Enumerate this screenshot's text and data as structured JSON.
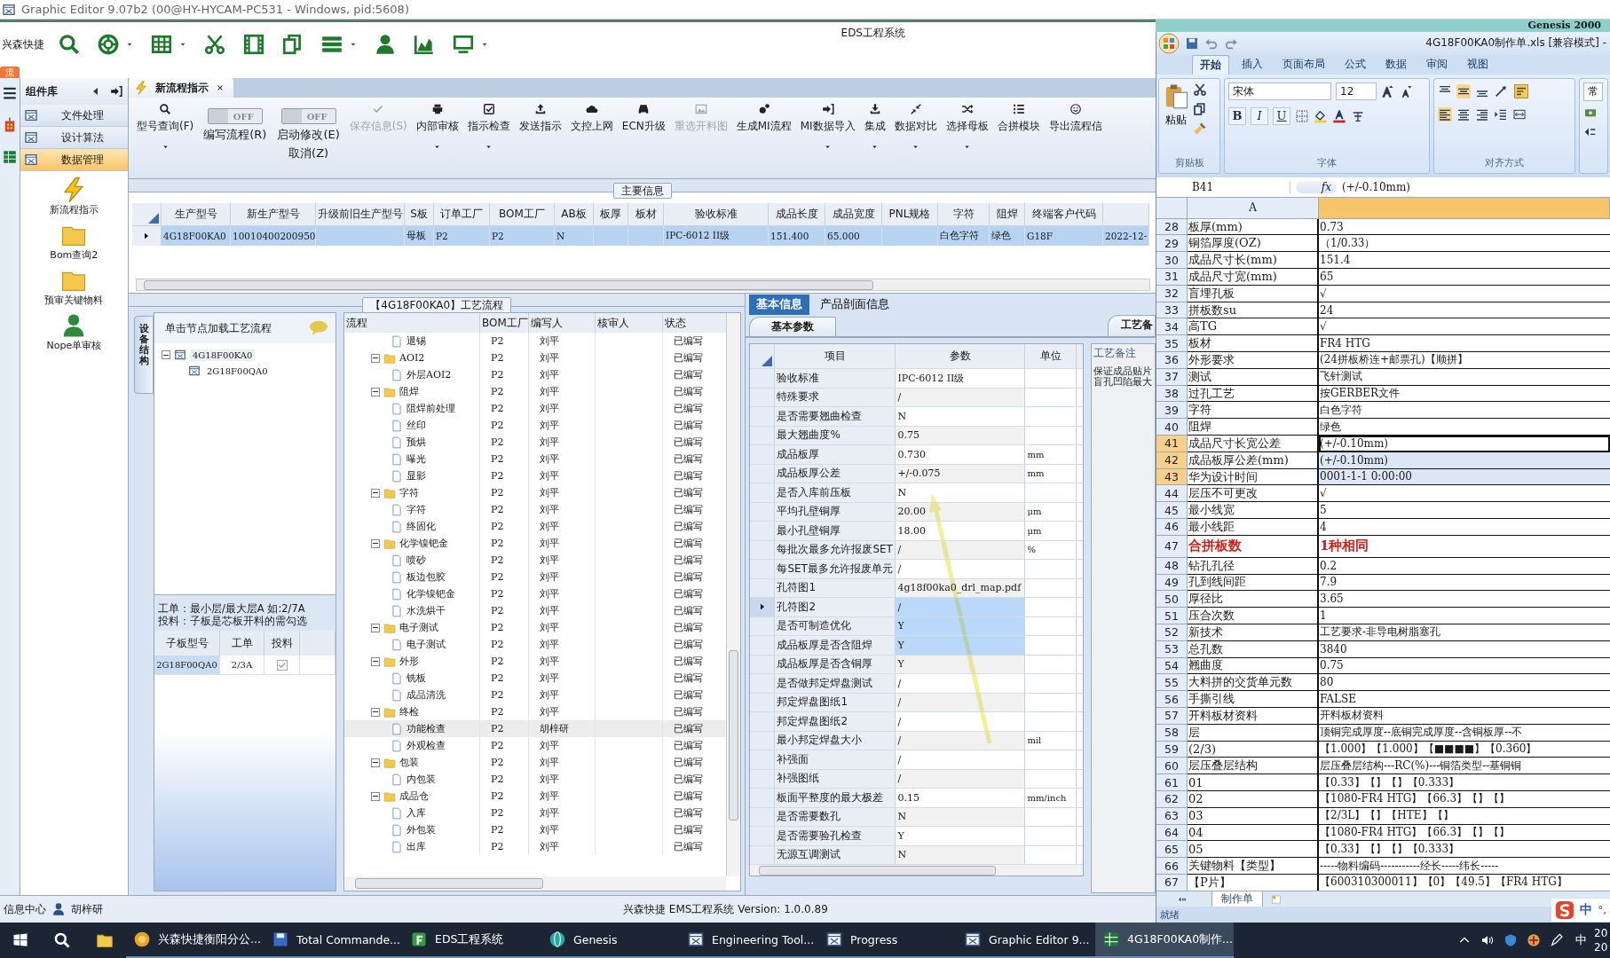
{
  "title_bar": {
    "title": "Graphic Editor 9.07b2 (00@HY-HYCAM-PC531 - Windows, pid:5608)"
  },
  "eds": {
    "quick_bar": {
      "label": "兴森快捷",
      "app_title": "EDS工程系统",
      "icons": [
        {
          "kind": "search",
          "dropdown": false
        },
        {
          "kind": "lifebuoy",
          "dropdown": true
        },
        {
          "kind": "grid",
          "dropdown": true
        },
        {
          "kind": "scissors",
          "dropdown": false
        },
        {
          "kind": "film",
          "dropdown": false
        },
        {
          "kind": "copy",
          "dropdown": false
        },
        {
          "kind": "list",
          "dropdown": true
        },
        {
          "kind": "person",
          "dropdown": false
        },
        {
          "kind": "chart",
          "dropdown": false
        },
        {
          "kind": "monitor",
          "dropdown": true
        }
      ]
    },
    "side_tab": "流",
    "component_library": {
      "title": "组件库",
      "groups": [
        {
          "label": "文件处理",
          "selected": false
        },
        {
          "label": "设计算法",
          "selected": false
        },
        {
          "label": "数据管理",
          "selected": true
        }
      ],
      "tools": [
        {
          "label": "新流程指示",
          "kind": "lightning"
        },
        {
          "label": "Bom查询2",
          "kind": "folder"
        },
        {
          "label": "预审关键物料",
          "kind": "folder"
        },
        {
          "label": "Nope单审核",
          "kind": "person"
        }
      ]
    },
    "doc_tab": {
      "label": "新流程指示"
    },
    "ribbon": [
      {
        "kind": "button",
        "label": "型号查询(F)",
        "dropdown": true,
        "disabled": false
      },
      {
        "kind": "toggle",
        "label": "编写流程(R)",
        "state_text": "OFF",
        "on": false
      },
      {
        "kind": "toggle",
        "label": "启动修改(E)",
        "label2": "取消(Z)",
        "state_text": "OFF",
        "on": false
      },
      {
        "kind": "button",
        "label": "保存信息(S)",
        "dropdown": false,
        "disabled": true
      },
      {
        "kind": "button",
        "label": "内部审核",
        "dropdown": true,
        "disabled": false
      },
      {
        "kind": "button",
        "label": "指示检查",
        "dropdown": true,
        "disabled": false
      },
      {
        "kind": "button",
        "label": "发送指示",
        "dropdown": false,
        "disabled": false
      },
      {
        "kind": "button",
        "label": "文控上网",
        "dropdown": false,
        "disabled": false
      },
      {
        "kind": "button",
        "label": "ECN升级",
        "dropdown": false,
        "disabled": false
      },
      {
        "kind": "button",
        "label": "重选开料图",
        "dropdown": false,
        "disabled": true
      },
      {
        "kind": "button",
        "label": "生成MI流程",
        "dropdown": false,
        "disabled": false
      },
      {
        "kind": "button",
        "label": "MI数据导入",
        "dropdown": true,
        "disabled": false
      },
      {
        "kind": "button",
        "label": "集成",
        "dropdown": true,
        "disabled": false
      },
      {
        "kind": "button",
        "label": "数据对比",
        "dropdown": true,
        "disabled": false
      },
      {
        "kind": "button",
        "label": "选择母板",
        "dropdown": true,
        "disabled": false
      },
      {
        "kind": "button",
        "label": "合拼模块",
        "dropdown": false,
        "disabled": false
      },
      {
        "kind": "button",
        "label": "导出流程信",
        "dropdown": false,
        "disabled": false
      }
    ],
    "main_info": {
      "caption": "主要信息",
      "columns": [
        {
          "label": "生产型号"
        },
        {
          "label": "新生产型号"
        },
        {
          "label": "升级前旧生产型号"
        },
        {
          "label": "S板"
        },
        {
          "label": "订单工厂"
        },
        {
          "label": "BOM工厂"
        },
        {
          "label": "AB板"
        },
        {
          "label": "板厚"
        },
        {
          "label": "板材"
        },
        {
          "label": "验收标准"
        },
        {
          "label": "成品长度"
        },
        {
          "label": "成品宽度"
        },
        {
          "label": "PNL规格"
        },
        {
          "label": "字符"
        },
        {
          "label": "阻焊"
        },
        {
          "label": "终端客户代码"
        },
        {}
      ],
      "rows": [
        {
          "selected": true,
          "cells": [
            "4G18F00KA0",
            "10010400200950",
            null,
            "母板",
            "P2",
            "P2",
            "N",
            null,
            null,
            "IPC-6012 II级",
            "151.400",
            "65.000",
            null,
            "白色字符",
            "绿色",
            "G18F",
            "2022-12-"
          ]
        }
      ]
    },
    "process": {
      "caption": "【4G18F00KA0】工艺流程",
      "side_tab": "设备结构",
      "hint": "单击节点加载工艺流程",
      "tree": [
        {
          "label": "4G18F00KA0",
          "selected": true,
          "expanded": true,
          "children": [
            {
              "label": "2G18F00QA0",
              "selected": false
            }
          ]
        }
      ],
      "notes": [
        "工单：最小层/最大层A 如:2/7A",
        "投料：子板是芯板开料的需勾选"
      ],
      "sub_table": {
        "columns": [
          "子板型号",
          "工单",
          "投料"
        ],
        "rows": [
          {
            "model": "2G18F00QA0",
            "order": "2/3A",
            "checked": true
          }
        ]
      },
      "grid": {
        "columns": [
          "流程",
          "BOM工厂",
          "编写人",
          "核审人",
          "状态"
        ],
        "items": [
          {
            "children": [
              {
                "label": "退锡",
                "bom": "P2",
                "writer": "刘平",
                "status": "已编写",
                "selected": false
              }
            ]
          },
          {
            "label": "AOI2",
            "bom": "P2",
            "writer": "刘平",
            "status": "已编写",
            "selected": false,
            "expanded": true,
            "children": [
              {
                "label": "外层AOI2",
                "bom": "P2",
                "writer": "刘平",
                "status": "已编写",
                "selected": false
              }
            ]
          },
          {
            "label": "阻焊",
            "bom": "P2",
            "writer": "刘平",
            "status": "已编写",
            "selected": false,
            "expanded": true,
            "children": [
              {
                "label": "阻焊前处理",
                "bom": "P2",
                "writer": "刘平",
                "status": "已编写",
                "selected": false
              },
              {
                "label": "丝印",
                "bom": "P2",
                "writer": "刘平",
                "status": "已编写",
                "selected": false
              },
              {
                "label": "预烘",
                "bom": "P2",
                "writer": "刘平",
                "status": "已编写",
                "selected": false
              },
              {
                "label": "曝光",
                "bom": "P2",
                "writer": "刘平",
                "status": "已编写",
                "selected": false
              },
              {
                "label": "显影",
                "bom": "P2",
                "writer": "刘平",
                "status": "已编写",
                "selected": false
              }
            ]
          },
          {
            "label": "字符",
            "bom": "P2",
            "writer": "刘平",
            "status": "已编写",
            "selected": false,
            "expanded": true,
            "children": [
              {
                "label": "字符",
                "bom": "P2",
                "writer": "刘平",
                "status": "已编写",
                "selected": false
              },
              {
                "label": "终固化",
                "bom": "P2",
                "writer": "刘平",
                "status": "已编写",
                "selected": false
              }
            ]
          },
          {
            "label": "化学镍钯金",
            "bom": "P2",
            "writer": "刘平",
            "status": "已编写",
            "selected": false,
            "expanded": true,
            "children": [
              {
                "label": "喷砂",
                "bom": "P2",
                "writer": "刘平",
                "status": "已编写",
                "selected": false
              },
              {
                "label": "板边包胶",
                "bom": "P2",
                "writer": "刘平",
                "status": "已编写",
                "selected": false
              },
              {
                "label": "化学镍钯金",
                "bom": "P2",
                "writer": "刘平",
                "status": "已编写",
                "selected": false
              },
              {
                "label": "水洗烘干",
                "bom": "P2",
                "writer": "刘平",
                "status": "已编写",
                "selected": false
              }
            ]
          },
          {
            "label": "电子测试",
            "bom": "P2",
            "writer": "刘平",
            "status": "已编写",
            "selected": false,
            "expanded": true,
            "children": [
              {
                "label": "电子测试",
                "bom": "P2",
                "writer": "刘平",
                "status": "已编写",
                "selected": false
              }
            ]
          },
          {
            "label": "外形",
            "bom": "P2",
            "writer": "刘平",
            "status": "已编写",
            "selected": false,
            "expanded": true,
            "children": [
              {
                "label": "铣板",
                "bom": "P2",
                "writer": "刘平",
                "status": "已编写",
                "selected": false
              },
              {
                "label": "成品清洗",
                "bom": "P2",
                "writer": "刘平",
                "status": "已编写",
                "selected": false
              }
            ]
          },
          {
            "label": "终检",
            "bom": "P2",
            "writer": "刘平",
            "status": "已编写",
            "selected": false,
            "expanded": true,
            "children": [
              {
                "label": "功能检查",
                "bom": "P2",
                "writer": "胡梓研",
                "status": "已编写",
                "selected": true
              },
              {
                "label": "外观检查",
                "bom": "P2",
                "writer": "刘平",
                "status": "已编写",
                "selected": false
              }
            ]
          },
          {
            "label": "包装",
            "bom": "P2",
            "writer": "刘平",
            "status": "已编写",
            "selected": false,
            "expanded": true,
            "children": [
              {
                "label": "内包装",
                "bom": "P2",
                "writer": "刘平",
                "status": "已编写",
                "selected": false
              }
            ]
          },
          {
            "label": "成品仓",
            "bom": "P2",
            "writer": "刘平",
            "status": "已编写",
            "selected": false,
            "expanded": true,
            "children": [
              {
                "label": "入库",
                "bom": "P2",
                "writer": "刘平",
                "status": "已编写",
                "selected": false
              },
              {
                "label": "外包装",
                "bom": "P2",
                "writer": "刘平",
                "status": "已编写",
                "selected": false
              },
              {
                "label": "出库",
                "bom": "P2",
                "writer": "刘平",
                "status": "已编写",
                "selected": false
              }
            ]
          }
        ]
      }
    },
    "params": {
      "tabs": [
        {
          "label": "基本信息",
          "selected": true
        },
        {
          "label": "产品剖面信息",
          "selected": false
        }
      ],
      "sub_tab": "基本参数",
      "columns": [
        "项目",
        "参数",
        "单位"
      ],
      "rows": [
        {
          "item": "验收标准",
          "value": "IPC-6012 II级",
          "selected": false,
          "current": false
        },
        {
          "item": "特殊要求",
          "value": "/",
          "selected": false,
          "current": false
        },
        {
          "item": "是否需要翘曲检查",
          "value": "N",
          "selected": false,
          "current": false
        },
        {
          "item": "最大翘曲度%",
          "value": "0.75",
          "selected": false,
          "current": false
        },
        {
          "item": "成品板厚",
          "value": "0.730",
          "unit": "mm",
          "selected": false,
          "current": false
        },
        {
          "item": "成品板厚公差",
          "value": "+/-0.075",
          "unit": "mm",
          "selected": false,
          "current": false
        },
        {
          "item": "是否入库前压板",
          "value": "N",
          "selected": false,
          "current": false
        },
        {
          "item": "平均孔壁铜厚",
          "value": "20.00",
          "unit": "μm",
          "selected": false,
          "current": false
        },
        {
          "item": "最小孔壁铜厚",
          "value": "18.00",
          "unit": "μm",
          "selected": false,
          "current": false
        },
        {
          "item": "每批次最多允许报废SET",
          "value": "/",
          "unit": "%",
          "selected": false,
          "current": false
        },
        {
          "item": "每SET最多允许报废单元",
          "value": "/",
          "selected": false,
          "current": false
        },
        {
          "item": "孔符图1",
          "value": "4g18f00ka0_drl_map.pdf",
          "selected": false,
          "current": false
        },
        {
          "item": "孔符图2",
          "value": "/",
          "selected": true,
          "current": true
        },
        {
          "item": "是否可制造优化",
          "value": "Y",
          "selected": true,
          "current": false
        },
        {
          "item": "成品板厚是否含阻焊",
          "value": "Y",
          "selected": true,
          "current": false
        },
        {
          "item": "成品板厚是否含铜厚",
          "value": "Y",
          "selected": false,
          "current": false
        },
        {
          "item": "是否做邦定焊盘测试",
          "value": "/",
          "selected": false,
          "current": false
        },
        {
          "item": "邦定焊盘图纸1",
          "value": "/",
          "selected": false,
          "current": false
        },
        {
          "item": "邦定焊盘图纸2",
          "value": "/",
          "selected": false,
          "current": false
        },
        {
          "item": "最小邦定焊盘大小",
          "value": "/",
          "unit": "mil",
          "selected": false,
          "current": false
        },
        {
          "item": "补强面",
          "value": "/",
          "selected": false,
          "current": false
        },
        {
          "item": "补强图纸",
          "value": "/",
          "selected": false,
          "current": false
        },
        {
          "item": "板面平整度的最大极差",
          "value": "0.15",
          "unit": "mm/inch",
          "selected": false,
          "current": false
        },
        {
          "item": "是否需要数孔",
          "value": "N",
          "selected": false,
          "current": false
        },
        {
          "item": "是否需要验孔检查",
          "value": "Y",
          "selected": false,
          "current": false
        },
        {
          "item": "无源互调测试",
          "value": "N",
          "selected": false,
          "current": false
        }
      ]
    },
    "remarks": {
      "tab": "工艺备",
      "label": "工艺备注",
      "lines": [
        "保证成品贴片",
        "盲孔凹陷最大"
      ]
    },
    "status_bar": {
      "info": "信息中心",
      "user": "胡梓研",
      "version": "兴森快捷 EMS工程系统 Version: 1.0.0.89"
    }
  },
  "genesis": {
    "title": "Genesis 2000"
  },
  "excel": {
    "title": "4G18F00KA0制作单.xls  [兼容模式] -",
    "tabs": [
      {
        "label": "开始",
        "selected": true
      },
      {
        "label": "插入",
        "selected": false
      },
      {
        "label": "页面布局",
        "selected": false
      },
      {
        "label": "公式",
        "selected": false
      },
      {
        "label": "数据",
        "selected": false
      },
      {
        "label": "审阅",
        "selected": false
      },
      {
        "label": "视图",
        "selected": false
      }
    ],
    "paste": "粘贴",
    "clipboard_group": "剪贴板",
    "font_name": "宋体",
    "font_size": "12",
    "bold": "B",
    "italic": "I",
    "underline": "U",
    "font_group": "字体",
    "align_group": "对齐方式",
    "number_format": "常",
    "name_box": "B41",
    "fx": "fx",
    "formula": "(+/-0.10mm)",
    "col_a": "A",
    "rows": [
      {
        "n": "28",
        "a": "板厚(mm)",
        "b": "0.73",
        "selected": false,
        "emphasis": false
      },
      {
        "n": "29",
        "a": "铜箔厚度(OZ)",
        "b": "（1/0.33）",
        "selected": false,
        "emphasis": false
      },
      {
        "n": "30",
        "a": "成品尺寸长(mm)",
        "b": "151.4",
        "selected": false,
        "emphasis": false
      },
      {
        "n": "31",
        "a": "成品尺寸宽(mm)",
        "b": "65",
        "selected": false,
        "emphasis": false
      },
      {
        "n": "32",
        "a": "盲埋孔板",
        "b": "√",
        "selected": false,
        "emphasis": false
      },
      {
        "n": "33",
        "a": "拼板数su",
        "b": "24",
        "selected": false,
        "emphasis": false
      },
      {
        "n": "34",
        "a": "高TG",
        "b": "√",
        "selected": false,
        "emphasis": false
      },
      {
        "n": "35",
        "a": "板材",
        "b": "FR4 HTG",
        "selected": false,
        "emphasis": false
      },
      {
        "n": "36",
        "a": "外形要求",
        "b": "(24拼板桥连+邮票孔)【顺拼】",
        "selected": false,
        "emphasis": false
      },
      {
        "n": "37",
        "a": "测试",
        "b": "飞针测试",
        "selected": false,
        "emphasis": false
      },
      {
        "n": "38",
        "a": "过孔工艺",
        "b": "按GERBER文件",
        "selected": false,
        "emphasis": false
      },
      {
        "n": "39",
        "a": "字符",
        "b": "白色字符",
        "selected": false,
        "emphasis": false
      },
      {
        "n": "40",
        "a": "阻焊",
        "b": "绿色",
        "selected": false,
        "emphasis": false
      },
      {
        "n": "41",
        "a": "成品尺寸长宽公差",
        "b": "(+/-0.10mm)",
        "selected": true,
        "emphasis": false
      },
      {
        "n": "42",
        "a": "成品板厚公差(mm)",
        "b": "(+/-0.10mm)",
        "selected": true,
        "emphasis": false
      },
      {
        "n": "43",
        "a": "华为设计时间",
        "b": "0001-1-1 0:00:00",
        "selected": true,
        "emphasis": false
      },
      {
        "n": "44",
        "a": "层压不可更改",
        "b": "√",
        "selected": false,
        "emphasis": false
      },
      {
        "n": "45",
        "a": "最小线宽",
        "b": "5",
        "selected": false,
        "emphasis": false
      },
      {
        "n": "46",
        "a": "最小线距",
        "b": "4",
        "selected": false,
        "emphasis": false
      },
      {
        "n": "47",
        "a": "合拼板数",
        "b": "1种相同",
        "selected": false,
        "emphasis": true
      },
      {
        "n": "48",
        "a": "钻孔孔径",
        "b": "0.2",
        "selected": false,
        "emphasis": false
      },
      {
        "n": "49",
        "a": "孔到线间距",
        "b": "7.9",
        "selected": false,
        "emphasis": false
      },
      {
        "n": "50",
        "a": "厚径比",
        "b": "3.65",
        "selected": false,
        "emphasis": false
      },
      {
        "n": "51",
        "a": "压合次数",
        "b": "1",
        "selected": false,
        "emphasis": false
      },
      {
        "n": "52",
        "a": "新技术",
        "b": "工艺要求-非导电树脂塞孔",
        "selected": false,
        "emphasis": false
      },
      {
        "n": "53",
        "a": "总孔数",
        "b": "3840",
        "selected": false,
        "emphasis": false
      },
      {
        "n": "54",
        "a": "翘曲度",
        "b": "0.75",
        "selected": false,
        "emphasis": false
      },
      {
        "n": "55",
        "a": "大料拼的交货单元数",
        "b": "80",
        "selected": false,
        "emphasis": false
      },
      {
        "n": "56",
        "a": "手撕引线",
        "b": "FALSE",
        "selected": false,
        "emphasis": false
      },
      {
        "n": "57",
        "a": "开料板材资料",
        "b": "开料板材资料",
        "selected": false,
        "emphasis": false
      },
      {
        "n": "58",
        "a": "层",
        "b": "顶铜完成厚度--底铜完成厚度--含铜板厚--不",
        "selected": false,
        "emphasis": false
      },
      {
        "n": "59",
        "a": "(2/3)",
        "b": "【1.000】【1.000】【■■■■】【0.360】",
        "selected": false,
        "emphasis": false
      },
      {
        "n": "60",
        "a": "层压叠层结构",
        "b": "层压叠层结构---RC(%)---铜箔类型--基铜铜",
        "selected": false,
        "emphasis": false
      },
      {
        "n": "61",
        "a": "01",
        "b": "【0.33】【】【】【0.333】",
        "selected": false,
        "emphasis": false
      },
      {
        "n": "62",
        "a": "02",
        "b": "【1080-FR4 HTG】【66.3】【】【】",
        "selected": false,
        "emphasis": false
      },
      {
        "n": "63",
        "a": "03",
        "b": "【2/3L】【】【HTE】【】",
        "selected": false,
        "emphasis": false
      },
      {
        "n": "64",
        "a": "04",
        "b": "【1080-FR4 HTG】【66.3】【】【】",
        "selected": false,
        "emphasis": false
      },
      {
        "n": "65",
        "a": "05",
        "b": "【0.33】【】【】【0.333】",
        "selected": false,
        "emphasis": false
      },
      {
        "n": "66",
        "a": "关键物料【类型】",
        "b": "-----物料编码-----------经长-----纬长-----",
        "selected": false,
        "emphasis": false
      },
      {
        "n": "67",
        "a": "【P片】",
        "b": "【600310300011】【0】【49.5】【FR4 HTG】",
        "selected": false,
        "emphasis": false
      }
    ],
    "sheet_tab": "制作单",
    "status": "就绪",
    "ime": {
      "mode": "中",
      "punct": "°,"
    }
  },
  "taskbar": {
    "apps": [
      {
        "label": "兴森快捷衡阳分公...",
        "selected": false
      },
      {
        "label": "Total Commande...",
        "selected": false
      },
      {
        "label": "EDS工程系统",
        "selected": false
      },
      {
        "label": "Genesis",
        "selected": false
      },
      {
        "label": "Engineering Tool...",
        "selected": false
      },
      {
        "label": "Progress",
        "selected": false
      },
      {
        "label": "Graphic Editor 9...",
        "selected": false
      },
      {
        "label": "4G18F00KA0制作...",
        "selected": true
      }
    ],
    "ime": "中",
    "clock": [
      "20",
      "20"
    ]
  }
}
